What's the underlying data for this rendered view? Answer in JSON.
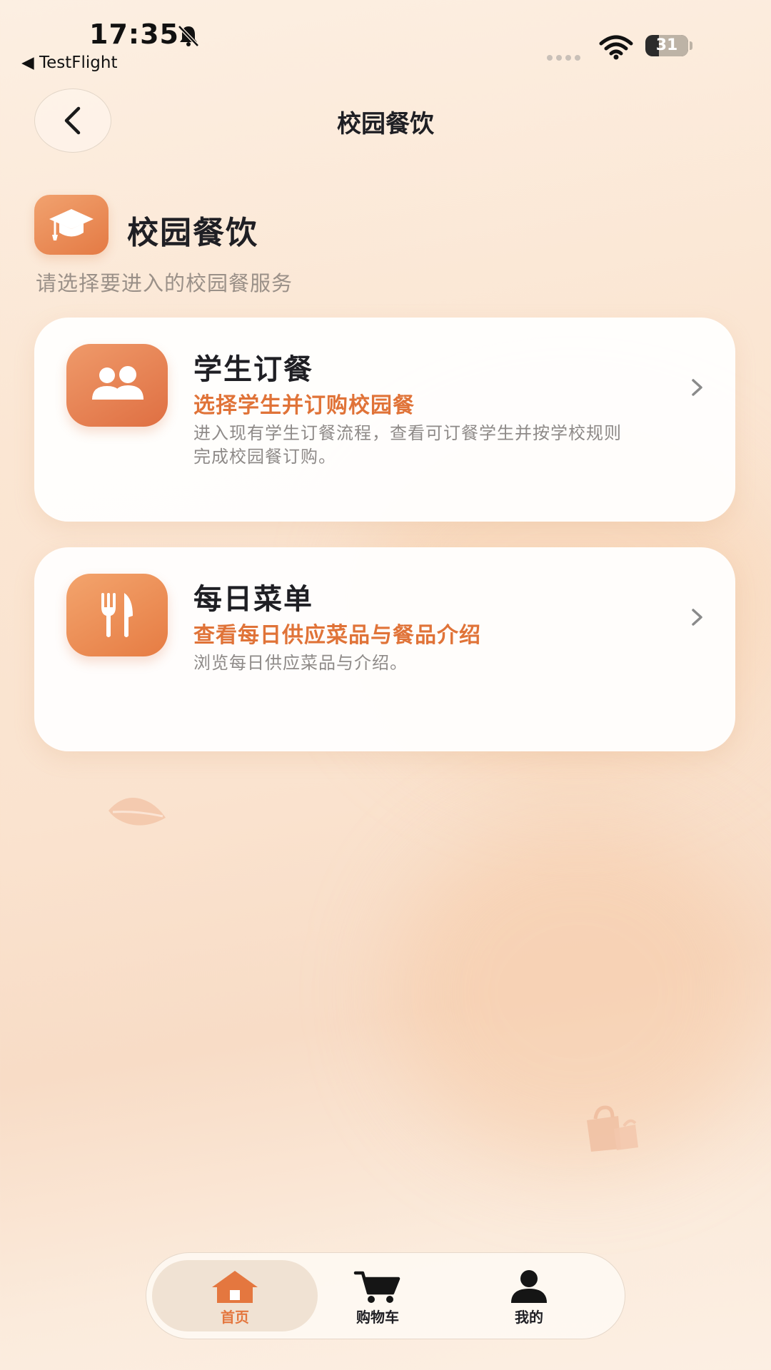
{
  "status_bar": {
    "time": "17:35",
    "back_app": "◀ TestFlight",
    "battery": "31",
    "battery_level": 0.31
  },
  "nav": {
    "title": "校园餐饮"
  },
  "header": {
    "title": "校园餐饮",
    "subtitle": "请选择要进入的校园餐服务"
  },
  "cards": [
    {
      "title": "学生订餐",
      "subtitle": "选择学生并订购校园餐",
      "description": "进入现有学生订餐流程，查看可订餐学生并按学校规则完成校园餐订购。",
      "icon": "students-icon"
    },
    {
      "title": "每日菜单",
      "subtitle": "查看每日供应菜品与餐品介绍",
      "description": "浏览每日供应菜品与介绍。",
      "icon": "fork-knife-icon"
    }
  ],
  "tabbar": {
    "items": [
      {
        "label": "首页",
        "icon": "home-icon",
        "active": true
      },
      {
        "label": "购物车",
        "icon": "cart-icon",
        "active": false
      },
      {
        "label": "我的",
        "icon": "profile-icon",
        "active": false
      }
    ]
  },
  "colors": {
    "accent": "#e4773f",
    "card_icon": "#e47a44",
    "background": "#fbe6d3"
  }
}
